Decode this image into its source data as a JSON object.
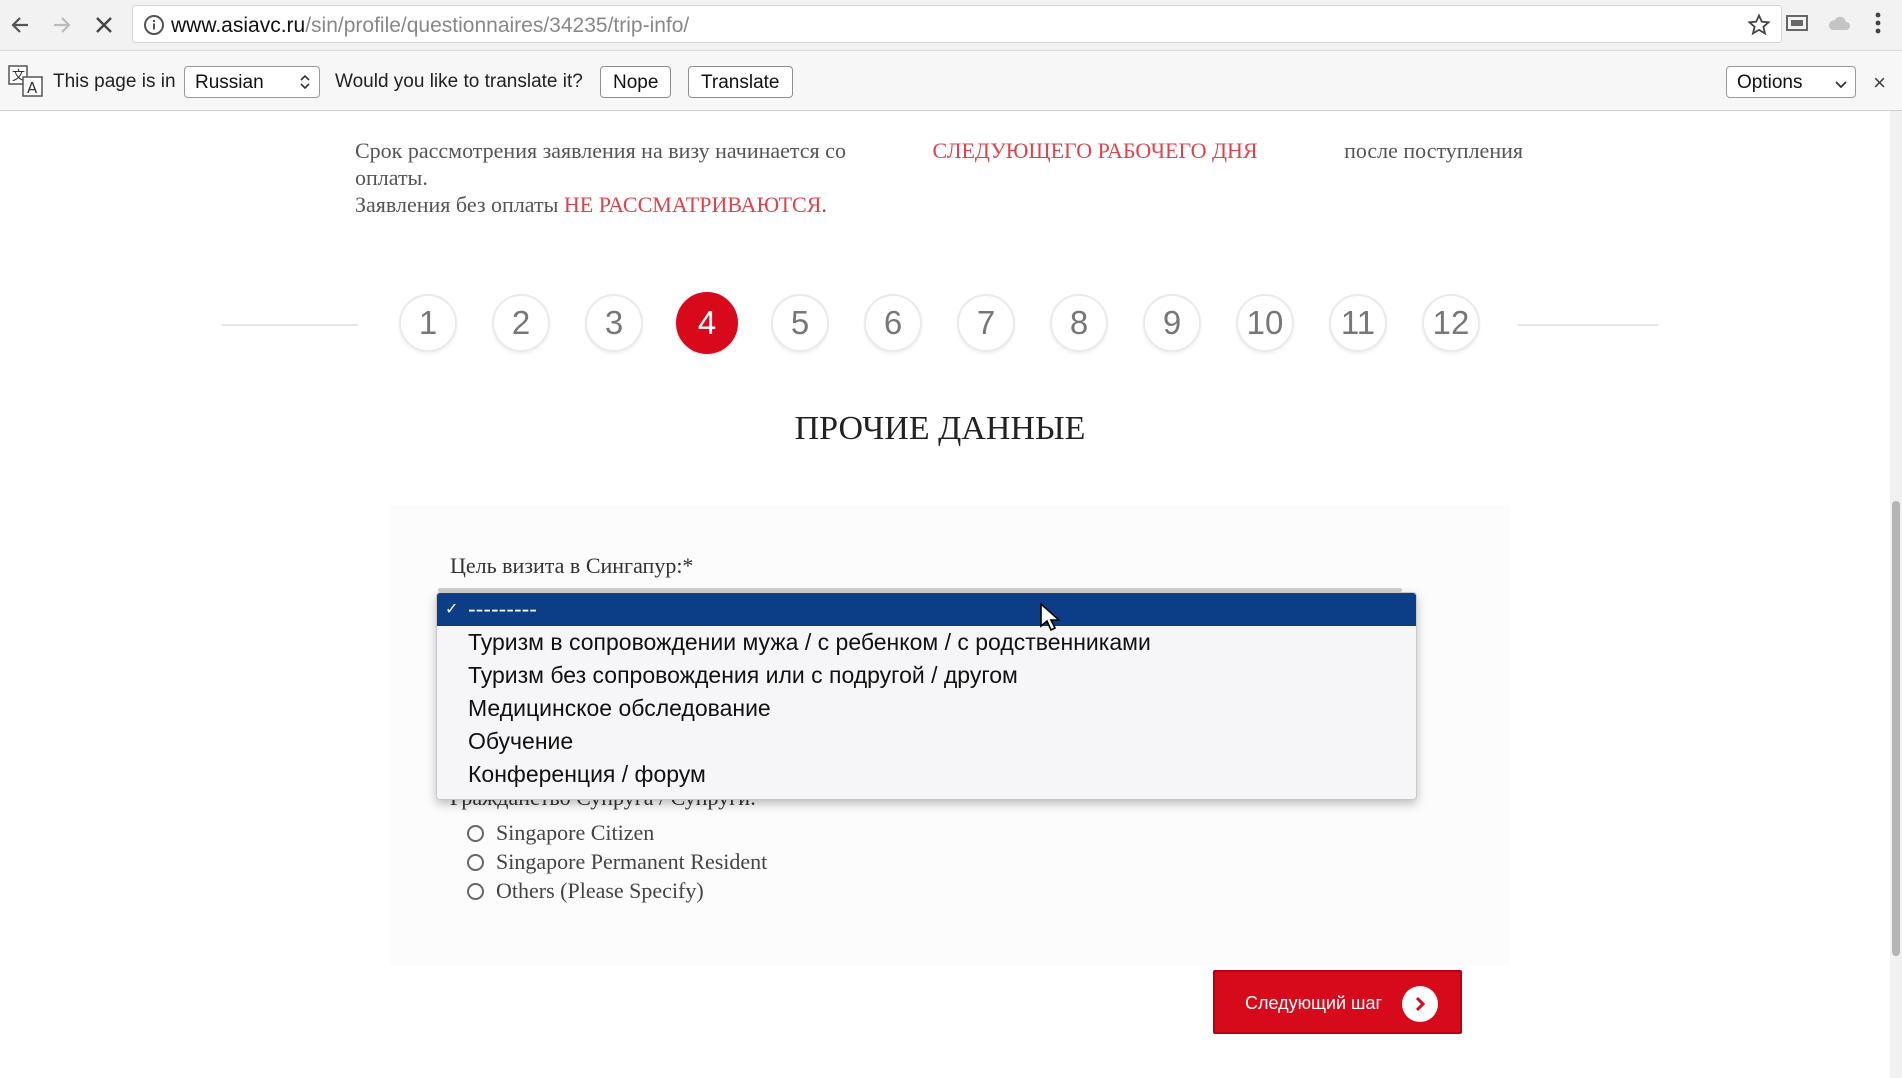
{
  "browser": {
    "url_host": "www.asiavc.ru",
    "url_path": "/sin/profile/questionnaires/34235/trip-info/"
  },
  "translate_bar": {
    "page_is_in": "This page is in",
    "language": "Russian",
    "question": "Would you like to translate it?",
    "nope_label": "Nope",
    "translate_label": "Translate",
    "options_label": "Options",
    "close_glyph": "×"
  },
  "notice": {
    "line1_a": "Срок рассмотрения заявления на визу начинается со",
    "line1_red": "СЛЕДУЮЩЕГО РАБОЧЕГО ДНЯ",
    "line1_b": "после поступления",
    "line2": "оплаты.",
    "line3_a": "Заявления без оплаты",
    "line3_red": "НЕ РАССМАТРИВАЮТСЯ",
    "line3_b": "."
  },
  "steps": [
    "1",
    "2",
    "3",
    "4",
    "5",
    "6",
    "7",
    "8",
    "9",
    "10",
    "11",
    "12"
  ],
  "active_step": "4",
  "section_title": "ПРОЧИЕ ДАННЫЕ",
  "form": {
    "purpose_label": "Цель визита в Сингапур:*",
    "options": [
      "---------",
      "Туризм в сопровождении мужа / с ребенком / с родственниками",
      "Туризм без сопровождения или с подругой / другом",
      "Медицинское обследование",
      "Обучение",
      "Конференция / форум"
    ],
    "selected_check": "✓",
    "spouse_label_partial": "Гражданство Супруга / Супруги:",
    "radios": [
      "Singapore Citizen",
      "Singapore Permanent Resident",
      "Others (Please Specify)"
    ],
    "next_label": "Следующий шаг"
  },
  "colors": {
    "accent_red": "#d9091c",
    "notice_red": "#e0424d",
    "dropdown_selected": "#0c3d87"
  }
}
